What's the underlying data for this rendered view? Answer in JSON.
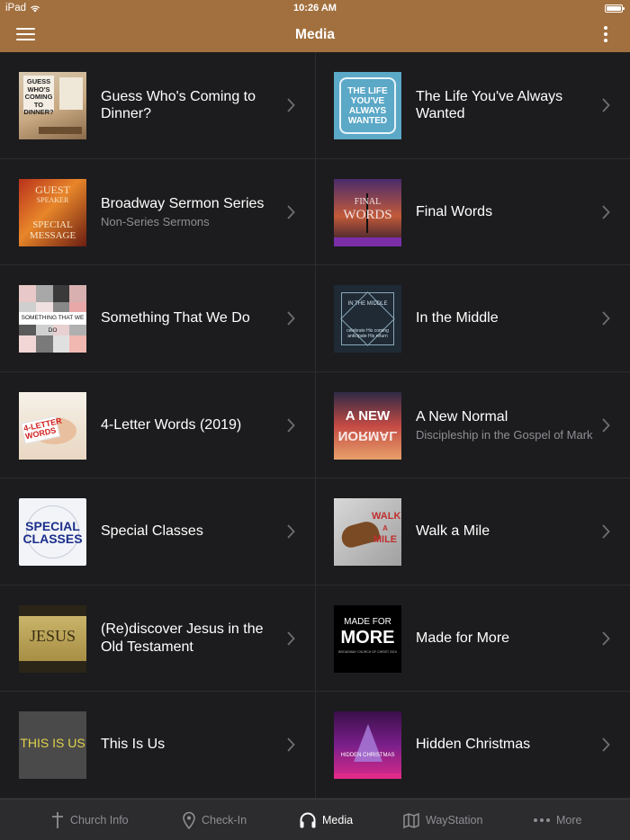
{
  "status_bar": {
    "carrier": "iPad",
    "time": "10:26 AM"
  },
  "nav": {
    "title": "Media"
  },
  "media": [
    {
      "title": "Guess Who's Coming to Dinner?",
      "subtitle": "",
      "art": [
        "GUESS",
        "WHO'S",
        "COMING",
        "TO",
        "DINNER?"
      ]
    },
    {
      "title": "The Life You've Always Wanted",
      "subtitle": "",
      "art": [
        "THE LIFE",
        "YOU'VE",
        "ALWAYS",
        "WANTED"
      ]
    },
    {
      "title": "Broadway Sermon Series",
      "subtitle": "Non-Series Sermons",
      "art": [
        "GUEST",
        "SPEAKER",
        "SPECIAL",
        "MESSAGE"
      ]
    },
    {
      "title": "Final Words",
      "subtitle": "",
      "art": [
        "FINAL",
        "WORDS"
      ]
    },
    {
      "title": "Something That We Do",
      "subtitle": "",
      "art": [
        "SOMETHING THAT WE DO"
      ]
    },
    {
      "title": "In the Middle",
      "subtitle": "",
      "art": [
        "IN THE MIDDLE",
        "celebrate His coming",
        "anticipate His return"
      ]
    },
    {
      "title": "4-Letter Words (2019)",
      "subtitle": "",
      "art": [
        "4-LETTER",
        "WORDS"
      ]
    },
    {
      "title": "A New Normal",
      "subtitle": "Discipleship in the Gospel of Mark",
      "art": [
        "A NEW",
        "NORMAL"
      ]
    },
    {
      "title": "Special Classes",
      "subtitle": "",
      "art": [
        "SPECIAL",
        "CLASSES"
      ]
    },
    {
      "title": "Walk a Mile",
      "subtitle": "",
      "art": [
        "WALK",
        "A",
        "MILE"
      ]
    },
    {
      "title": "(Re)discover Jesus in the Old Testament",
      "subtitle": "",
      "art": [
        "JESUS"
      ]
    },
    {
      "title": "Made for More",
      "subtitle": "",
      "art": [
        "MADE FOR",
        "MORE",
        "BROADWAY CHURCH OF CHRIST 2019"
      ]
    },
    {
      "title": "This Is Us",
      "subtitle": "",
      "art": [
        "THIS IS US"
      ]
    },
    {
      "title": "Hidden Christmas",
      "subtitle": "",
      "art": [
        "HIDDEN CHRISTMAS"
      ]
    }
  ],
  "tabs": [
    {
      "label": "Church Info",
      "icon": "cross-icon",
      "active": false
    },
    {
      "label": "Check-In",
      "icon": "location-pin-icon",
      "active": false
    },
    {
      "label": "Media",
      "icon": "headphones-icon",
      "active": true
    },
    {
      "label": "WayStation",
      "icon": "map-icon",
      "active": false
    },
    {
      "label": "More",
      "icon": "ellipsis-icon",
      "active": false
    }
  ],
  "colors": {
    "brand": "#a2703f",
    "background": "#1c1c1e",
    "tabbar": "#2c2c2e",
    "active_tab": "#ffffff",
    "inactive_tab": "#8e8e93"
  }
}
